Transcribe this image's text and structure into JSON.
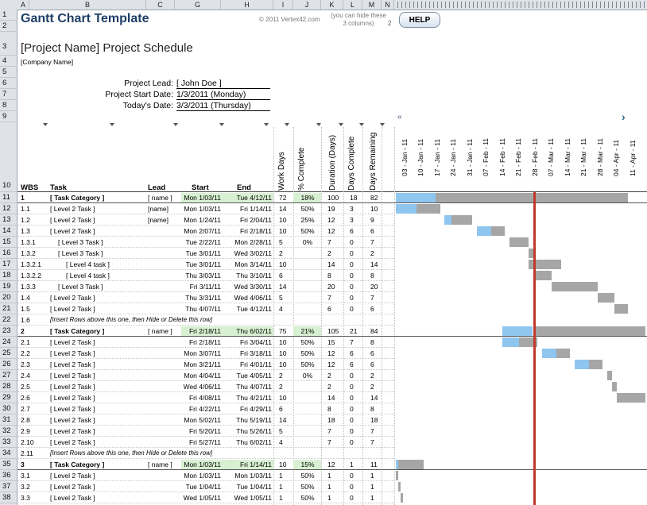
{
  "columns": [
    "A",
    "B",
    "C",
    "G",
    "H",
    "I",
    "J",
    "K",
    "L",
    "M",
    "N"
  ],
  "title": "Gantt Chart Template",
  "copyright": "© 2011 Vertex42.com",
  "hide_note": "(you can hide these 3 columns)",
  "hide_note_num": "2",
  "help_label": "HELP",
  "project_title": "[Project Name] Project Schedule",
  "company": "[Company Name]",
  "info": {
    "lead_label": "Project Lead:",
    "lead_value": "[ John Doe ]",
    "start_label": "Project Start Date:",
    "start_value": "1/3/2011 (Monday)",
    "today_label": "Today's Date:",
    "today_value": "3/3/2011 (Thursday)"
  },
  "nav": {
    "left": "«",
    "right": "›"
  },
  "headers": {
    "wbs": "WBS",
    "task": "Task",
    "lead": "Lead",
    "start": "Start",
    "end": "End",
    "work_days": "Work Days",
    "pct": "% Complete",
    "duration": "Duration (Days)",
    "days_complete": "Days Complete",
    "days_remaining": "Days Remaining"
  },
  "weeks": [
    "03 - Jan - 11",
    "10 - Jan - 11",
    "17 - Jan - 11",
    "24 - Jan - 11",
    "31 - Jan - 11",
    "07 - Feb - 11",
    "14 - Feb - 11",
    "21 - Feb - 11",
    "28 - Feb - 11",
    "07 - Mar - 11",
    "14 - Mar - 11",
    "21 - Mar - 11",
    "28 - Mar - 11",
    "04 - Apr - 11",
    "11 - Apr - 11"
  ],
  "row_numbers": [
    "1",
    "2",
    "3",
    "4",
    "5",
    "6",
    "7",
    "8",
    "9",
    "10",
    "11",
    "12",
    "13",
    "14",
    "15",
    "16",
    "17",
    "18",
    "19",
    "20",
    "21",
    "22",
    "23",
    "24",
    "25",
    "26",
    "27",
    "28",
    "29",
    "30",
    "31",
    "32",
    "33",
    "34",
    "35",
    "36",
    "37",
    "38"
  ],
  "rows": [
    {
      "wbs": "1",
      "task": "[ Task Category ]",
      "lead": "[ name ]",
      "start": "Mon 1/03/11",
      "end": "Tue 4/12/11",
      "wd": "72",
      "pct": "18%",
      "dur": "100",
      "dc": "18",
      "dr": "82",
      "cat": true,
      "indent": 0,
      "gantt": {
        "start": "2011-01-03",
        "done": "2011-01-20",
        "end": "2011-04-12"
      }
    },
    {
      "wbs": "1.1",
      "task": "[ Level 2 Task ]",
      "lead": "[name]",
      "start": "Mon 1/03/11",
      "end": "Fri 1/14/11",
      "wd": "14",
      "pct": "50%",
      "dur": "19",
      "dc": "3",
      "dr": "10",
      "cat": false,
      "indent": 1,
      "gantt": {
        "start": "2011-01-03",
        "done": "2011-01-12",
        "end": "2011-01-21"
      }
    },
    {
      "wbs": "1.2",
      "task": "[ Level 2 Task ]",
      "lead": "[name]",
      "start": "Mon 1/24/11",
      "end": "Fri 2/04/11",
      "wd": "10",
      "pct": "25%",
      "dur": "12",
      "dc": "3",
      "dr": "9",
      "cat": false,
      "indent": 1,
      "gantt": {
        "start": "2011-01-24",
        "done": "2011-01-27",
        "end": "2011-02-04"
      }
    },
    {
      "wbs": "1.3",
      "task": "[ Level 2 Task ]",
      "lead": "",
      "start": "Mon 2/07/11",
      "end": "Fri 2/18/11",
      "wd": "10",
      "pct": "50%",
      "dur": "12",
      "dc": "6",
      "dr": "6",
      "cat": false,
      "indent": 1,
      "gantt": {
        "start": "2011-02-07",
        "done": "2011-02-13",
        "end": "2011-02-18"
      }
    },
    {
      "wbs": "1.3.1",
      "task": "[ Level 3 Task ]",
      "lead": "",
      "start": "Tue 2/22/11",
      "end": "Mon 2/28/11",
      "wd": "5",
      "pct": "0%",
      "dur": "7",
      "dc": "0",
      "dr": "7",
      "cat": false,
      "indent": 2,
      "gantt": {
        "start": "2011-02-21",
        "done": "2011-02-21",
        "end": "2011-02-28"
      }
    },
    {
      "wbs": "1.3.2",
      "task": "[ Level 3 Task ]",
      "lead": "",
      "start": "Tue 3/01/11",
      "end": "Wed 3/02/11",
      "wd": "2",
      "pct": "",
      "dur": "2",
      "dc": "0",
      "dr": "2",
      "cat": false,
      "indent": 2,
      "gantt": {
        "start": "2011-03-01",
        "done": "2011-03-01",
        "end": "2011-03-02"
      }
    },
    {
      "wbs": "1.3.2.1",
      "task": "[ Level 4 task ]",
      "lead": "",
      "start": "Tue 3/01/11",
      "end": "Mon 3/14/11",
      "wd": "10",
      "pct": "",
      "dur": "14",
      "dc": "0",
      "dr": "14",
      "cat": false,
      "indent": 3,
      "gantt": {
        "start": "2011-03-01",
        "done": "2011-03-01",
        "end": "2011-03-14"
      }
    },
    {
      "wbs": "1.3.2.2",
      "task": "[ Level 4 task ]",
      "lead": "",
      "start": "Thu 3/03/11",
      "end": "Thu 3/10/11",
      "wd": "6",
      "pct": "",
      "dur": "8",
      "dc": "0",
      "dr": "8",
      "cat": false,
      "indent": 3,
      "gantt": {
        "start": "2011-03-03",
        "done": "2011-03-03",
        "end": "2011-03-10"
      }
    },
    {
      "wbs": "1.3.3",
      "task": "[ Level 3 Task ]",
      "lead": "",
      "start": "Fri 3/11/11",
      "end": "Wed 3/30/11",
      "wd": "14",
      "pct": "",
      "dur": "20",
      "dc": "0",
      "dr": "20",
      "cat": false,
      "indent": 2,
      "gantt": {
        "start": "2011-03-11",
        "done": "2011-03-11",
        "end": "2011-03-30"
      }
    },
    {
      "wbs": "1.4",
      "task": "[ Level 2 Task ]",
      "lead": "",
      "start": "Thu 3/31/11",
      "end": "Wed 4/06/11",
      "wd": "5",
      "pct": "",
      "dur": "7",
      "dc": "0",
      "dr": "7",
      "cat": false,
      "indent": 1,
      "gantt": {
        "start": "2011-03-31",
        "done": "2011-03-31",
        "end": "2011-04-06"
      }
    },
    {
      "wbs": "1.5",
      "task": "[ Level 2 Task ]",
      "lead": "",
      "start": "Thu 4/07/11",
      "end": "Tue 4/12/11",
      "wd": "4",
      "pct": "",
      "dur": "6",
      "dc": "0",
      "dr": "6",
      "cat": false,
      "indent": 1,
      "gantt": {
        "start": "2011-04-07",
        "done": "2011-04-07",
        "end": "2011-04-12"
      }
    },
    {
      "wbs": "1.6",
      "task": "[Insert Rows above this one, then Hide or Delete this row]",
      "insert": true
    },
    {
      "wbs": "2",
      "task": "[ Task Category ]",
      "lead": "[ name ]",
      "start": "Fri 2/18/11",
      "end": "Thu 6/02/11",
      "wd": "75",
      "pct": "21%",
      "dur": "105",
      "dc": "21",
      "dr": "84",
      "cat": true,
      "indent": 0,
      "gantt": {
        "start": "2011-02-18",
        "done": "2011-03-03",
        "end": "2011-06-02"
      }
    },
    {
      "wbs": "2.1",
      "task": "[ Level 2 Task ]",
      "lead": "",
      "start": "Fri 2/18/11",
      "end": "Fri 3/04/11",
      "wd": "10",
      "pct": "50%",
      "dur": "15",
      "dc": "7",
      "dr": "8",
      "cat": false,
      "indent": 1,
      "gantt": {
        "start": "2011-02-18",
        "done": "2011-02-25",
        "end": "2011-03-04"
      }
    },
    {
      "wbs": "2.2",
      "task": "[ Level 2 Task ]",
      "lead": "",
      "start": "Mon 3/07/11",
      "end": "Fri 3/18/11",
      "wd": "10",
      "pct": "50%",
      "dur": "12",
      "dc": "6",
      "dr": "6",
      "cat": false,
      "indent": 1,
      "gantt": {
        "start": "2011-03-07",
        "done": "2011-03-13",
        "end": "2011-03-18"
      }
    },
    {
      "wbs": "2.3",
      "task": "[ Level 2 Task ]",
      "lead": "",
      "start": "Mon 3/21/11",
      "end": "Fri 4/01/11",
      "wd": "10",
      "pct": "50%",
      "dur": "12",
      "dc": "6",
      "dr": "6",
      "cat": false,
      "indent": 1,
      "gantt": {
        "start": "2011-03-21",
        "done": "2011-03-27",
        "end": "2011-04-01"
      }
    },
    {
      "wbs": "2.4",
      "task": "[ Level 2 Task ]",
      "lead": "",
      "start": "Mon 4/04/11",
      "end": "Tue 4/05/11",
      "wd": "2",
      "pct": "0%",
      "dur": "2",
      "dc": "0",
      "dr": "2",
      "cat": false,
      "indent": 1,
      "gantt": {
        "start": "2011-04-04",
        "done": "2011-04-04",
        "end": "2011-04-05"
      }
    },
    {
      "wbs": "2.5",
      "task": "[ Level 2 Task ]",
      "lead": "",
      "start": "Wed 4/06/11",
      "end": "Thu 4/07/11",
      "wd": "2",
      "pct": "",
      "dur": "2",
      "dc": "0",
      "dr": "2",
      "cat": false,
      "indent": 1,
      "gantt": {
        "start": "2011-04-06",
        "done": "2011-04-06",
        "end": "2011-04-07"
      }
    },
    {
      "wbs": "2.6",
      "task": "[ Level 2 Task ]",
      "lead": "",
      "start": "Fri 4/08/11",
      "end": "Thu 4/21/11",
      "wd": "10",
      "pct": "",
      "dur": "14",
      "dc": "0",
      "dr": "14",
      "cat": false,
      "indent": 1,
      "gantt": {
        "start": "2011-04-08",
        "done": "2011-04-08",
        "end": "2011-04-21"
      }
    },
    {
      "wbs": "2.7",
      "task": "[ Level 2 Task ]",
      "lead": "",
      "start": "Fri 4/22/11",
      "end": "Fri 4/29/11",
      "wd": "6",
      "pct": "",
      "dur": "8",
      "dc": "0",
      "dr": "8",
      "cat": false,
      "indent": 1,
      "gantt": null
    },
    {
      "wbs": "2.8",
      "task": "[ Level 2 Task ]",
      "lead": "",
      "start": "Mon 5/02/11",
      "end": "Thu 5/19/11",
      "wd": "14",
      "pct": "",
      "dur": "18",
      "dc": "0",
      "dr": "18",
      "cat": false,
      "indent": 1,
      "gantt": null
    },
    {
      "wbs": "2.9",
      "task": "[ Level 2 Task ]",
      "lead": "",
      "start": "Fri 5/20/11",
      "end": "Thu 5/26/11",
      "wd": "5",
      "pct": "",
      "dur": "7",
      "dc": "0",
      "dr": "7",
      "cat": false,
      "indent": 1,
      "gantt": null
    },
    {
      "wbs": "2.10",
      "task": "[ Level 2 Task ]",
      "lead": "",
      "start": "Fri 5/27/11",
      "end": "Thu 6/02/11",
      "wd": "4",
      "pct": "",
      "dur": "7",
      "dc": "0",
      "dr": "7",
      "cat": false,
      "indent": 1,
      "gantt": null
    },
    {
      "wbs": "2.11",
      "task": "[Insert Rows above this one, then Hide or Delete this row]",
      "insert": true
    },
    {
      "wbs": "3",
      "task": "[ Task Category ]",
      "lead": "[ name ]",
      "start": "Mon 1/03/11",
      "end": "Fri 1/14/11",
      "wd": "10",
      "pct": "15%",
      "dur": "12",
      "dc": "1",
      "dr": "11",
      "cat": true,
      "indent": 0,
      "gantt": {
        "start": "2011-01-03",
        "done": "2011-01-04",
        "end": "2011-01-14"
      }
    },
    {
      "wbs": "3.1",
      "task": "[ Level 2 Task ]",
      "lead": "",
      "start": "Mon 1/03/11",
      "end": "Mon 1/03/11",
      "wd": "1",
      "pct": "50%",
      "dur": "1",
      "dc": "0",
      "dr": "1",
      "cat": false,
      "indent": 1,
      "gantt": {
        "start": "2011-01-03",
        "done": "2011-01-03",
        "end": "2011-01-03"
      }
    },
    {
      "wbs": "3.2",
      "task": "[ Level 2 Task ]",
      "lead": "",
      "start": "Tue 1/04/11",
      "end": "Tue 1/04/11",
      "wd": "1",
      "pct": "50%",
      "dur": "1",
      "dc": "0",
      "dr": "1",
      "cat": false,
      "indent": 1,
      "gantt": {
        "start": "2011-01-04",
        "done": "2011-01-04",
        "end": "2011-01-04"
      }
    },
    {
      "wbs": "3.3",
      "task": "[ Level 2 Task ]",
      "lead": "",
      "start": "Wed 1/05/11",
      "end": "Wed 1/05/11",
      "wd": "1",
      "pct": "50%",
      "dur": "1",
      "dc": "0",
      "dr": "1",
      "cat": false,
      "indent": 1,
      "gantt": {
        "start": "2011-01-05",
        "done": "2011-01-05",
        "end": "2011-01-05"
      }
    }
  ],
  "colors": {
    "done": "#8fc6f0",
    "remaining": "#a6a6a6",
    "today_line": "#c0392b",
    "cat_fill": "#d8f0d2",
    "title": "#1e3f66"
  },
  "today": "2011-03-03",
  "timeline_start": "2011-01-03",
  "timeline_end": "2011-04-17"
}
